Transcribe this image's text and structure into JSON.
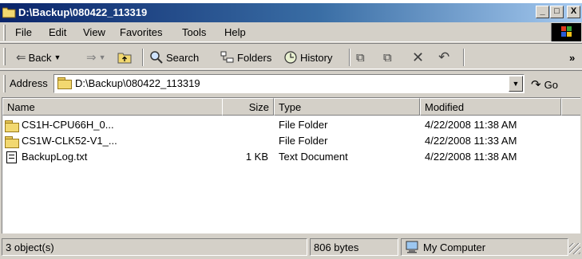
{
  "window": {
    "title": "D:\\Backup\\080422_113319",
    "controls": [
      "_",
      "□",
      "X"
    ]
  },
  "menu": [
    "File",
    "Edit",
    "View",
    "Favorites",
    "Tools",
    "Help"
  ],
  "toolbar": {
    "back_label": "Back",
    "search_label": "Search",
    "folders_label": "Folders",
    "history_label": "History",
    "overflow": "»"
  },
  "address": {
    "label": "Address",
    "value": "D:\\Backup\\080422_113319",
    "go_label": "Go"
  },
  "list": {
    "columns": [
      "Name",
      "Size",
      "Type",
      "Modified"
    ],
    "rows": [
      {
        "icon": "folder-icon",
        "name": "CS1H-CPU66H_0...",
        "size": "",
        "type": "File Folder",
        "modified": "4/22/2008 11:38 AM"
      },
      {
        "icon": "folder-icon",
        "name": "CS1W-CLK52-V1_...",
        "size": "",
        "type": "File Folder",
        "modified": "4/22/2008 11:33 AM"
      },
      {
        "icon": "text-document-icon",
        "name": "BackupLog.txt",
        "size": "1 KB",
        "type": "Text Document",
        "modified": "4/22/2008 11:38 AM"
      }
    ]
  },
  "status": {
    "objects": "3 object(s)",
    "bytes": "806 bytes",
    "location": "My Computer"
  },
  "colors": {
    "title_gradient_start": "#0a246a",
    "title_gradient_end": "#a6caf0",
    "chrome": "#d4d0c8"
  }
}
